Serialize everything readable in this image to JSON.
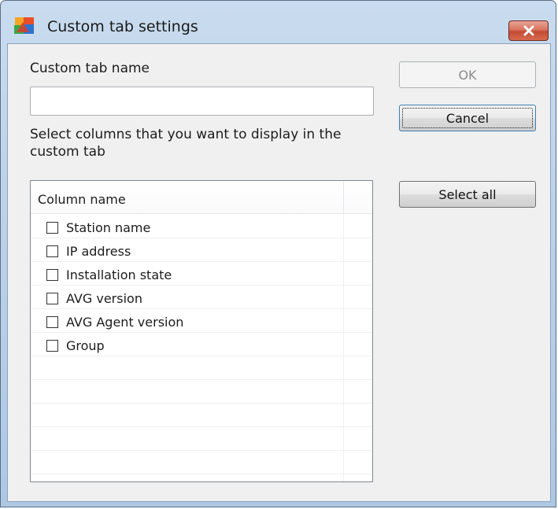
{
  "window": {
    "title": "Custom tab settings"
  },
  "form": {
    "name_label": "Custom tab name",
    "name_value": "",
    "columns_label_line1": "Select columns that you want to display in the",
    "columns_label_line2": "custom tab"
  },
  "list": {
    "header": "Column name",
    "items": [
      {
        "label": "Station name",
        "checked": false
      },
      {
        "label": "IP address",
        "checked": false
      },
      {
        "label": "Installation state",
        "checked": false
      },
      {
        "label": "AVG version",
        "checked": false
      },
      {
        "label": "AVG Agent version",
        "checked": false
      },
      {
        "label": "Group",
        "checked": false
      }
    ]
  },
  "buttons": {
    "ok": "OK",
    "cancel": "Cancel",
    "select_all": "Select all"
  },
  "icons": {
    "app": "avg-logo-icon",
    "close": "close-icon"
  },
  "colors": {
    "close_button": "#c94f37",
    "titlebar": "#bcd2e9"
  }
}
